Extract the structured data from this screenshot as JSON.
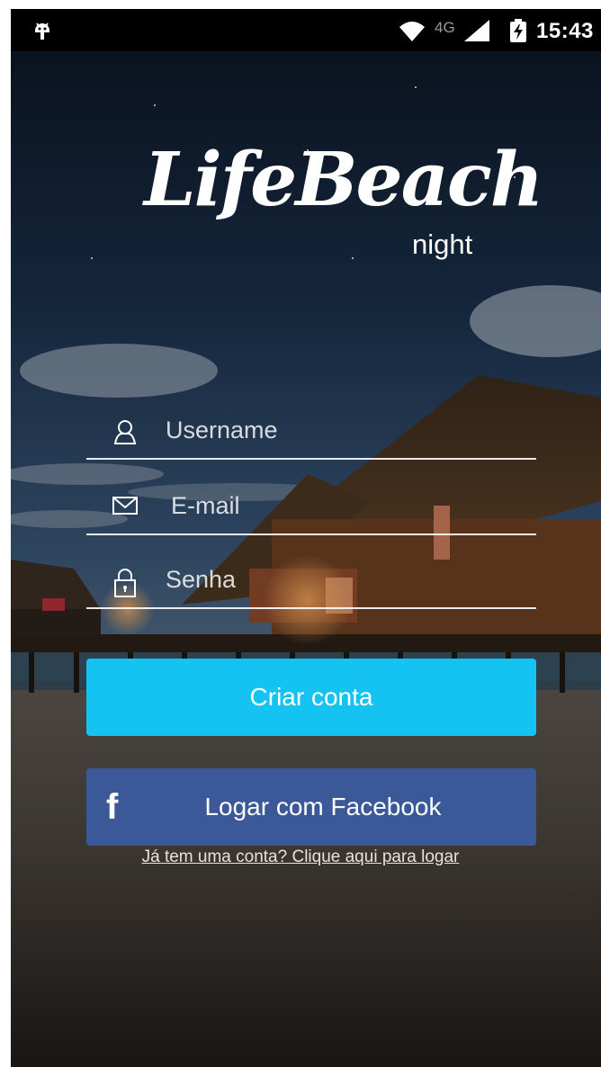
{
  "status_bar": {
    "network_label": "4G",
    "clock": "15:43",
    "icons": [
      "android-icon",
      "wifi-icon",
      "signal-icon",
      "battery-charging-icon"
    ]
  },
  "logo": {
    "title": "LifeBeach",
    "subtitle": "night"
  },
  "form": {
    "username_placeholder": "Username",
    "email_placeholder": "E-mail",
    "password_placeholder": "Senha",
    "icons": [
      "user-icon",
      "mail-icon",
      "lock-icon"
    ]
  },
  "buttons": {
    "create_account": "Criar conta",
    "facebook_icon_glyph": "f",
    "facebook_login": "Logar com Facebook"
  },
  "login_link": "Já tem uma conta? Clique aqui para logar",
  "colors": {
    "primary_button": "#14c3f2",
    "facebook_button": "#3b5998",
    "status_bar": "#000000"
  }
}
